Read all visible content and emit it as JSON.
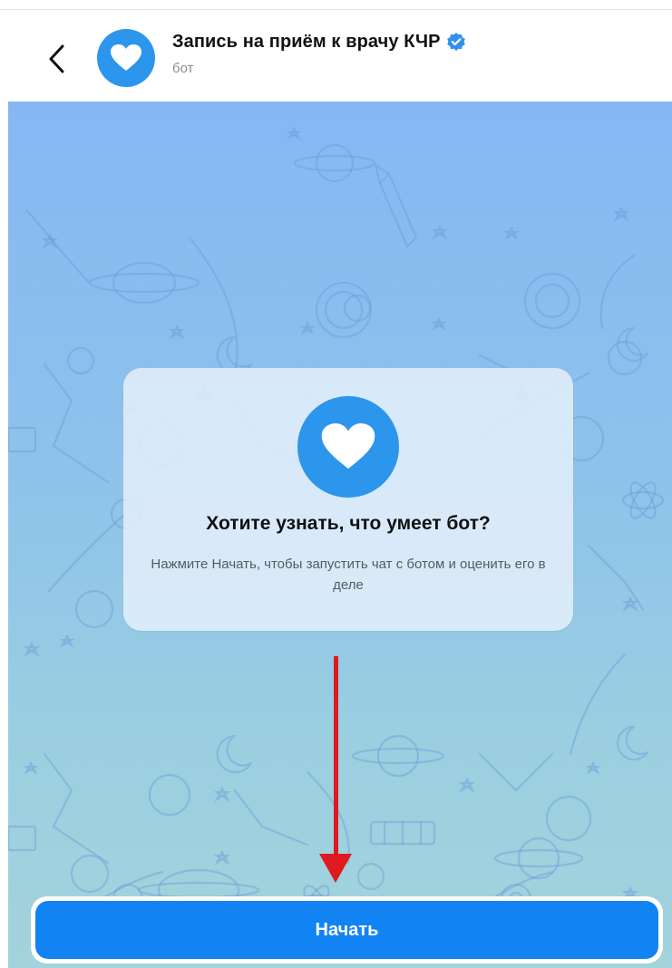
{
  "header": {
    "title": "Запись на приём к врачу КЧР",
    "subtitle": "бот",
    "verified": true,
    "avatar_icon": "heart-icon",
    "back_icon": "chevron-left-icon"
  },
  "card": {
    "icon": "heart-icon",
    "title": "Хотите узнать, что умеет бот?",
    "description": "Нажмите Начать, чтобы запустить чат с ботом и оценить его в деле"
  },
  "start_button": {
    "label": "Начать"
  },
  "colors": {
    "accent": "#1283f3",
    "avatar": "#2c95ec",
    "verified_badge": "#3390ec",
    "annotation_arrow": "#e0191f",
    "chat_background_top": "#86b7f4",
    "chat_background_bottom": "#a3d3dc"
  }
}
